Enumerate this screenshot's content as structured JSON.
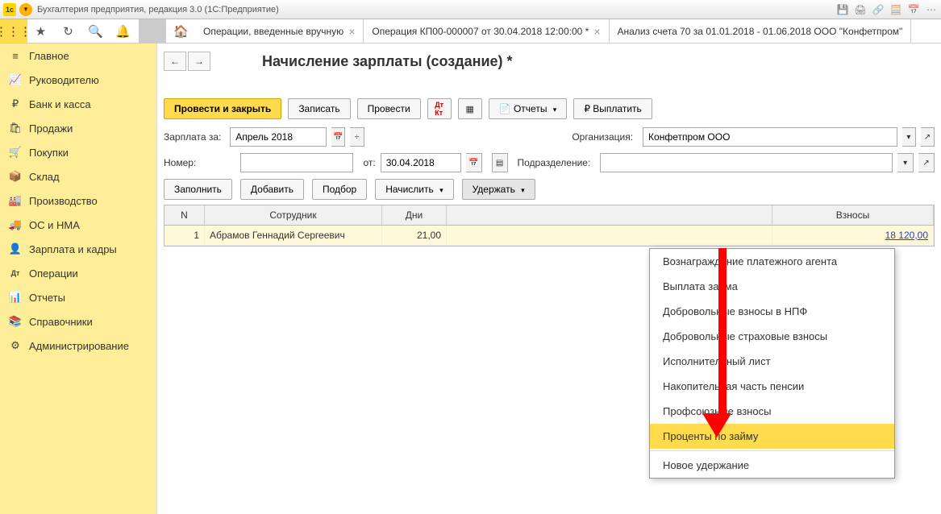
{
  "titlebar": {
    "title": "Бухгалтерия предприятия, редакция 3.0  (1С:Предприятие)"
  },
  "tabs": [
    {
      "label": "Операции, введенные вручную",
      "close": true
    },
    {
      "label": "Операция КП00-000007 от 30.04.2018 12:00:00 *",
      "close": true
    },
    {
      "label": "Анализ счета 70 за 01.01.2018 - 01.06.2018 ООО \"Конфетпром\""
    }
  ],
  "sidebar": [
    {
      "icon": "≡",
      "label": "Главное"
    },
    {
      "icon": "📈",
      "label": "Руководителю"
    },
    {
      "icon": "₽",
      "label": "Банк и касса"
    },
    {
      "icon": "🛍",
      "label": "Продажи"
    },
    {
      "icon": "🛒",
      "label": "Покупки"
    },
    {
      "icon": "📦",
      "label": "Склад"
    },
    {
      "icon": "🏭",
      "label": "Производство"
    },
    {
      "icon": "🚚",
      "label": "ОС и НМА"
    },
    {
      "icon": "👤",
      "label": "Зарплата и кадры"
    },
    {
      "icon": "Дт",
      "label": "Операции"
    },
    {
      "icon": "📊",
      "label": "Отчеты"
    },
    {
      "icon": "📚",
      "label": "Справочники"
    },
    {
      "icon": "⚙",
      "label": "Администрирование"
    }
  ],
  "page": {
    "title": "Начисление зарплаты (создание) *"
  },
  "actions": {
    "submit": "Провести и закрыть",
    "save": "Записать",
    "post": "Провести",
    "reports": "Отчеты",
    "pay": "Выплатить"
  },
  "fields": {
    "salary_for_label": "Зарплата за:",
    "salary_for_value": "Апрель 2018",
    "org_label": "Организация:",
    "org_value": "Конфетпром ООО",
    "number_label": "Номер:",
    "number_value": "",
    "from_label": "от:",
    "date_value": "30.04.2018",
    "division_label": "Подразделение:",
    "division_value": ""
  },
  "gridbar": {
    "fill": "Заполнить",
    "add": "Добавить",
    "pick": "Подбор",
    "accrue": "Начислить",
    "deduct": "Удержать"
  },
  "grid": {
    "head": {
      "n": "N",
      "emp": "Сотрудник",
      "days": "Дни",
      "vzn": "Взносы"
    },
    "rows": [
      {
        "n": "1",
        "emp": "Абрамов Геннадий Сергеевич",
        "days": "21,00",
        "vzn": "18 120,00"
      }
    ]
  },
  "dropdown": {
    "items": [
      "Вознаграждение платежного агента",
      "Выплата займа",
      "Добровольные взносы в НПФ",
      "Добровольные страховые взносы",
      "Исполнительный лист",
      "Накопительная часть пенсии",
      "Профсоюзные взносы",
      "Проценты по займу"
    ],
    "new": "Новое удержание",
    "selected": 7
  }
}
